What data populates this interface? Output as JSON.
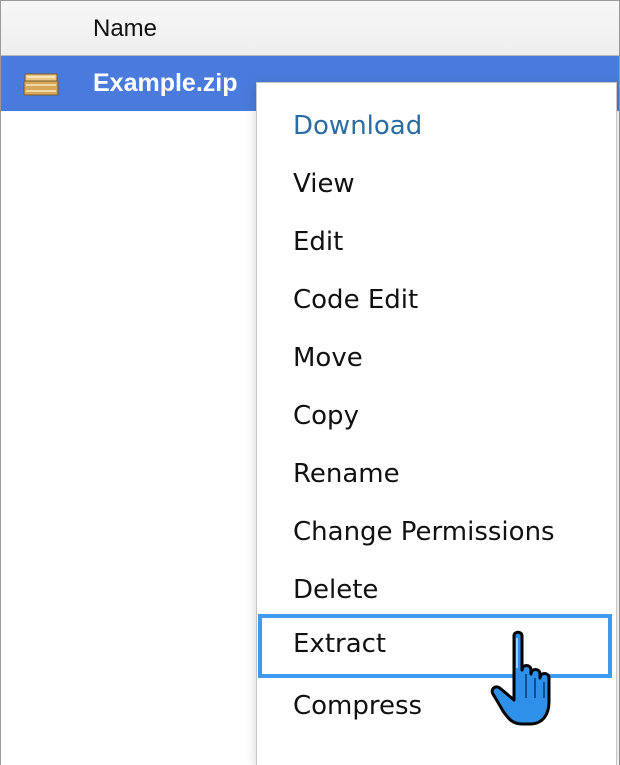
{
  "table": {
    "header_name": "Name",
    "rows": [
      {
        "icon": "archive-icon",
        "label": "Example.zip",
        "selected": true
      }
    ]
  },
  "context_menu": {
    "items": [
      {
        "label": "Download",
        "style": "primary"
      },
      {
        "label": "View"
      },
      {
        "label": "Edit"
      },
      {
        "label": "Code Edit"
      },
      {
        "label": "Move"
      },
      {
        "label": "Copy"
      },
      {
        "label": "Rename"
      },
      {
        "label": "Change Permissions"
      },
      {
        "label": "Delete"
      },
      {
        "label": "Extract",
        "highlighted": true
      },
      {
        "label": "Compress"
      }
    ]
  },
  "colors": {
    "selected_row": "#4a7bdc",
    "primary_item": "#2b6ca3",
    "highlight_border": "#3e9bef",
    "cursor_fill": "#2f90ea"
  },
  "cursor": {
    "icon": "hand-pointer-icon"
  }
}
